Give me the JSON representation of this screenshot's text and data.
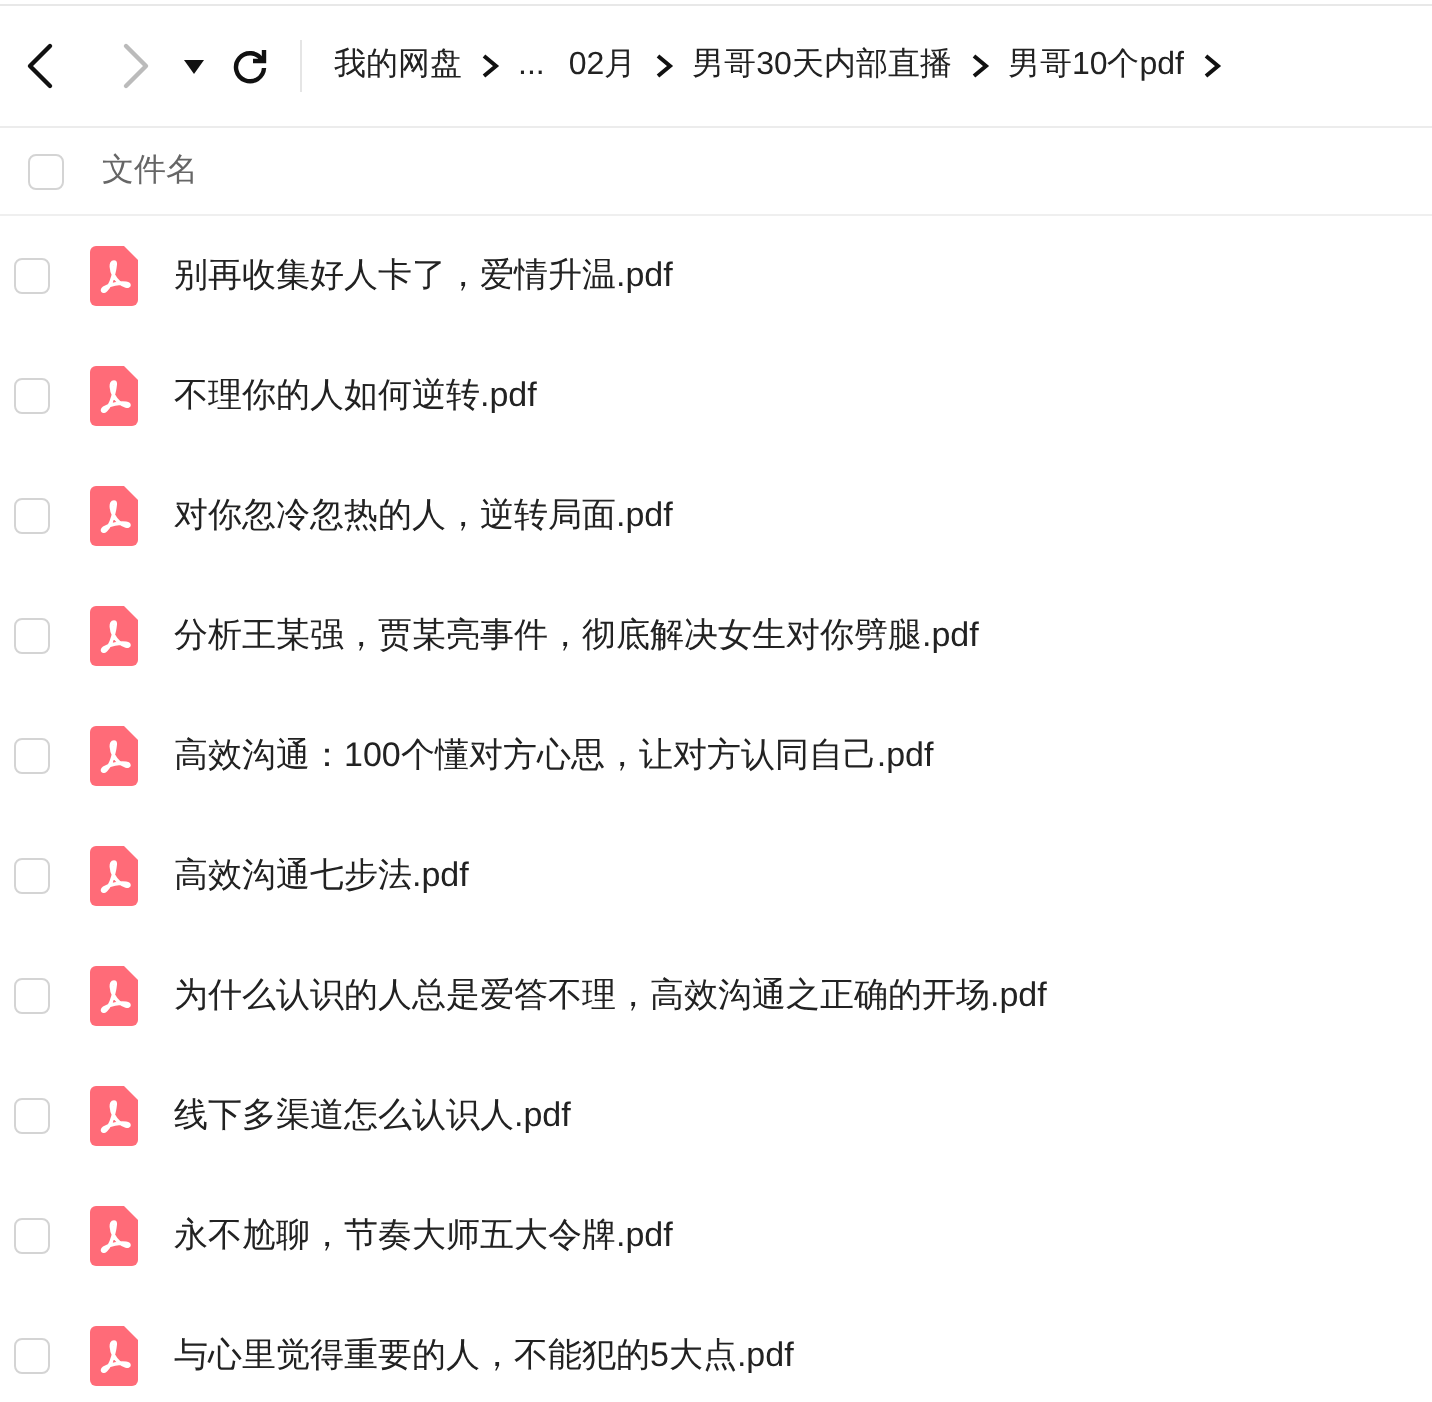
{
  "toolbar": {
    "back_disabled": false,
    "forward_disabled": true
  },
  "breadcrumb": [
    {
      "kind": "link",
      "label": "我的网盘"
    },
    {
      "kind": "more",
      "label": "..."
    },
    {
      "kind": "link",
      "label": "02月"
    },
    {
      "kind": "link",
      "label": "男哥30天内部直播"
    },
    {
      "kind": "link",
      "label": "男哥10个pdf"
    }
  ],
  "header": {
    "checked": false,
    "column": "文件名"
  },
  "files": [
    {
      "name": "别再收集好人卡了，爱情升温.pdf",
      "checked": false
    },
    {
      "name": "不理你的人如何逆转.pdf",
      "checked": false
    },
    {
      "name": "对你忽冷忽热的人，逆转局面.pdf",
      "checked": false
    },
    {
      "name": "分析王某强，贾某亮事件，彻底解决女生对你劈腿.pdf",
      "checked": false
    },
    {
      "name": "高效沟通：100个懂对方心思，让对方认同自己.pdf",
      "checked": false
    },
    {
      "name": "高效沟通七步法.pdf",
      "checked": false
    },
    {
      "name": "为什么认识的人总是爱答不理，高效沟通之正确的开场.pdf",
      "checked": false
    },
    {
      "name": "线下多渠道怎么认识人.pdf",
      "checked": false
    },
    {
      "name": "永不尬聊，节奏大师五大令牌.pdf",
      "checked": false
    },
    {
      "name": "与心里觉得重要的人，不能犯的5大点.pdf",
      "checked": false
    }
  ]
}
